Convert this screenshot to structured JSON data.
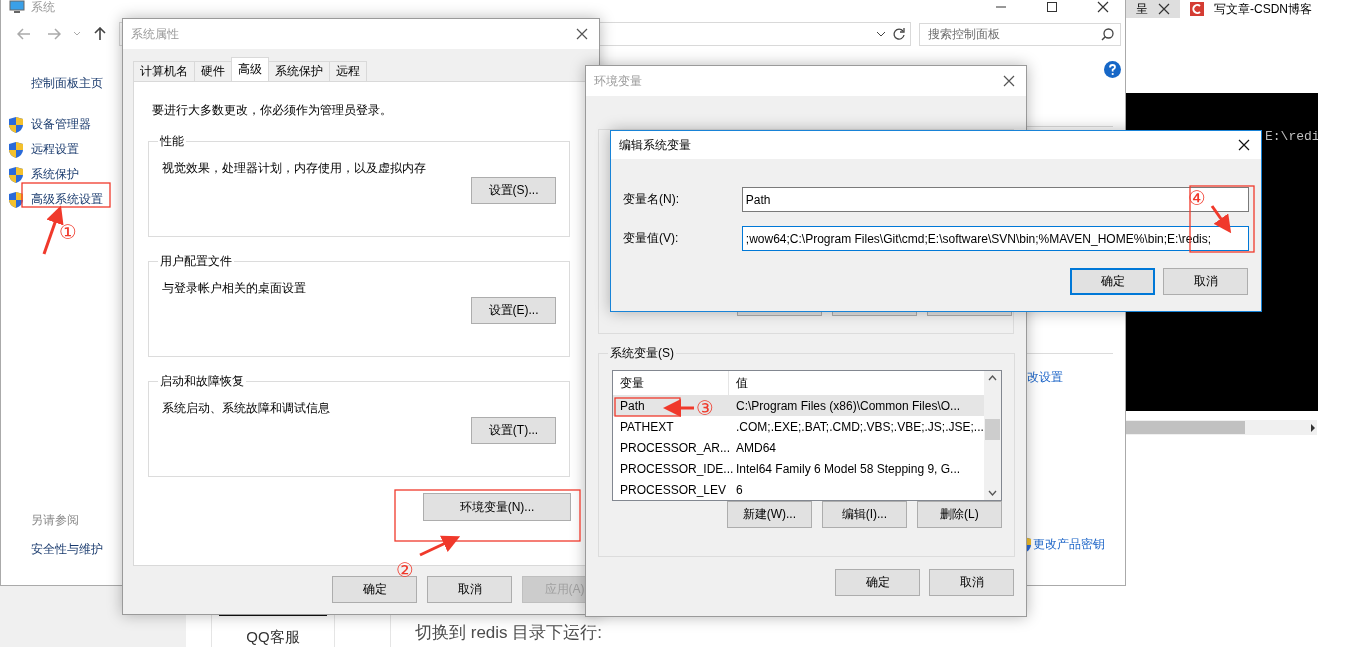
{
  "browser_tabs": [
    {
      "label": "呈",
      "selected": true
    },
    {
      "label": "写文章-CSDN博客",
      "selected": false
    }
  ],
  "terminal": {
    "text": "E:\\redi"
  },
  "web_page": {
    "sidebar_label": "QQ客服",
    "article_text": "切换到 redis 目录下运行:"
  },
  "control_panel": {
    "title": "系统",
    "search": {
      "placeholder": "搜索控制面板"
    },
    "home_link": "控制面板主页",
    "tasks": [
      "设备管理器",
      "远程设置",
      "系统保护",
      "高级系统设置"
    ],
    "see_also": {
      "heading": "另请参阅",
      "links": [
        "安全性与维护"
      ]
    },
    "content_links": [
      "改设置",
      "更改产品密钥"
    ]
  },
  "system_properties": {
    "title": "系统属性",
    "tabs": [
      {
        "label": "计算机名",
        "selected": false
      },
      {
        "label": "硬件",
        "selected": false
      },
      {
        "label": "高级",
        "selected": true
      },
      {
        "label": "系统保护",
        "selected": false
      },
      {
        "label": "远程",
        "selected": false
      }
    ],
    "notice": "要进行大多数更改，你必须作为管理员登录。",
    "groups": [
      {
        "title": "性能",
        "description": "视觉效果，处理器计划，内存使用，以及虚拟内存",
        "button": "设置(S)..."
      },
      {
        "title": "用户配置文件",
        "description": "与登录帐户相关的桌面设置",
        "button": "设置(E)..."
      },
      {
        "title": "启动和故障恢复",
        "description": "系统启动、系统故障和调试信息",
        "button": "设置(T)..."
      }
    ],
    "env_button": "环境变量(N)...",
    "buttons": [
      {
        "label": "确定",
        "disabled": false
      },
      {
        "label": "取消",
        "disabled": false
      },
      {
        "label": "应用(A)",
        "disabled": true
      }
    ]
  },
  "environment_variables": {
    "title": "环境变量",
    "system_group": {
      "title": "系统变量(S)",
      "columns": [
        "变量",
        "值"
      ],
      "rows": [
        {
          "name": "Path",
          "value": "C:\\Program Files (x86)\\Common Files\\O...",
          "selected": true
        },
        {
          "name": "PATHEXT",
          "value": ".COM;.EXE;.BAT;.CMD;.VBS;.VBE;.JS;.JSE;...",
          "selected": false
        },
        {
          "name": "PROCESSOR_AR...",
          "value": "AMD64",
          "selected": false
        },
        {
          "name": "PROCESSOR_IDE...",
          "value": "Intel64 Family 6 Model 58 Stepping 9, G...",
          "selected": false
        },
        {
          "name": "PROCESSOR_LEV",
          "value": "6",
          "selected": false
        }
      ]
    },
    "group_buttons": [
      "新建(W)...",
      "编辑(I)...",
      "删除(L)"
    ],
    "buttons": [
      "确定",
      "取消"
    ]
  },
  "edit_dialog": {
    "title": "编辑系统变量",
    "fields": [
      {
        "label": "变量名(N):",
        "value": "Path",
        "focused": false
      },
      {
        "label": "变量值(V):",
        "value": ";wow64;C:\\Program Files\\Git\\cmd;E:\\software\\SVN\\bin;%MAVEN_HOME%\\bin;E:\\redis;",
        "focused": true
      }
    ],
    "buttons": [
      {
        "label": "确定",
        "default": true
      },
      {
        "label": "取消",
        "default": false
      }
    ]
  },
  "annotations": [
    {
      "number": "①"
    },
    {
      "number": "②"
    },
    {
      "number": "③"
    },
    {
      "number": "④"
    }
  ]
}
